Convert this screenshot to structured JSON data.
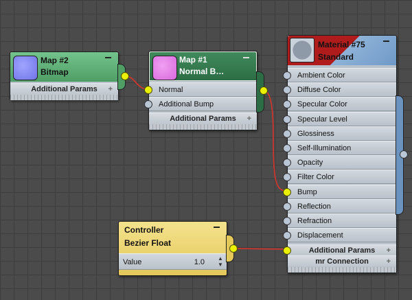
{
  "colors": {
    "wire": "#d9342b",
    "port": "#e9f000",
    "mat_tab": "#6b93bf"
  },
  "map2": {
    "title": "Map #2",
    "type": "Bitmap",
    "params_label": "Additional Params",
    "swatch_color": "#8a8ef2"
  },
  "map1": {
    "title": "Map #1",
    "type": "Normal B…",
    "params_label": "Additional Params",
    "swatch_color": "#e07de6",
    "slots": [
      "Normal",
      "Additional Bump"
    ]
  },
  "material": {
    "title": "Material #75",
    "type": "Standard",
    "slots": [
      "Ambient Color",
      "Diffuse Color",
      "Specular Color",
      "Specular Level",
      "Glossiness",
      "Self-Illumination",
      "Opacity",
      "Filter Color",
      "Bump",
      "Reflection",
      "Refraction",
      "Displacement"
    ],
    "params_label": "Additional Params",
    "mr_label": "mr Connection"
  },
  "controller": {
    "title": "Controller",
    "type": "Bezier Float",
    "value_label": "Value",
    "value": "1.0"
  }
}
